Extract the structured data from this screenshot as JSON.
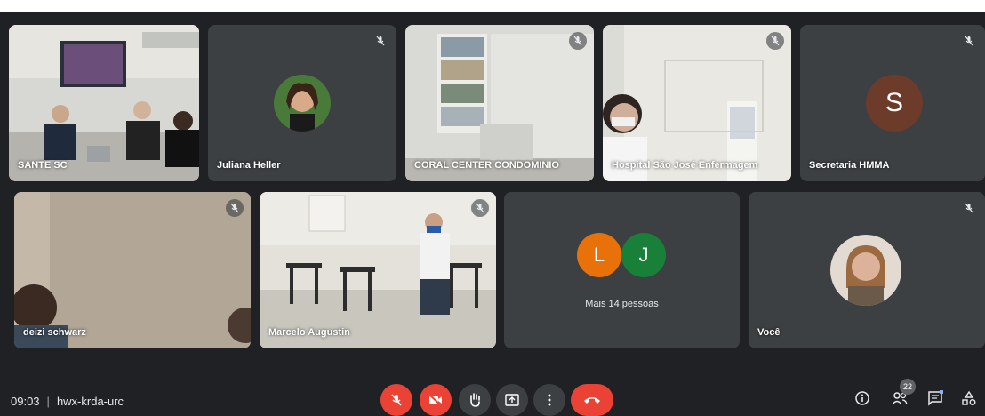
{
  "participants": [
    {
      "name": "SANTE SC"
    },
    {
      "name": "Juliana Heller"
    },
    {
      "name": "CORAL CENTER CONDOMINIO"
    },
    {
      "name": "Hospital São José Enfermagem"
    },
    {
      "name": "Secretaria HMMA",
      "initial": "S",
      "color": "#6d3b2a"
    },
    {
      "name": "deizi schwarz"
    },
    {
      "name": "Marcelo Augustin"
    },
    {
      "name": "Você"
    }
  ],
  "others_tile": {
    "initials": [
      {
        "letter": "L",
        "color": "#e8710a"
      },
      {
        "letter": "J",
        "color": "#188038"
      }
    ],
    "label": "Mais 14 pessoas"
  },
  "meeting": {
    "time": "09:03",
    "code": "hwx-krda-urc"
  },
  "controls": [
    {
      "name": "mic-off-button",
      "icon": "mic-off-icon"
    },
    {
      "name": "camera-off-button",
      "icon": "camera-off-icon"
    },
    {
      "name": "raise-hand-button",
      "icon": "hand-icon"
    },
    {
      "name": "present-button",
      "icon": "present-icon"
    },
    {
      "name": "more-options-button",
      "icon": "more-vert-icon"
    },
    {
      "name": "leave-call-button",
      "icon": "call-end-icon"
    }
  ],
  "right_controls": {
    "people_count": "22"
  },
  "colors": {
    "background": "#202124",
    "tile": "#3c4043",
    "danger": "#ea4335"
  }
}
